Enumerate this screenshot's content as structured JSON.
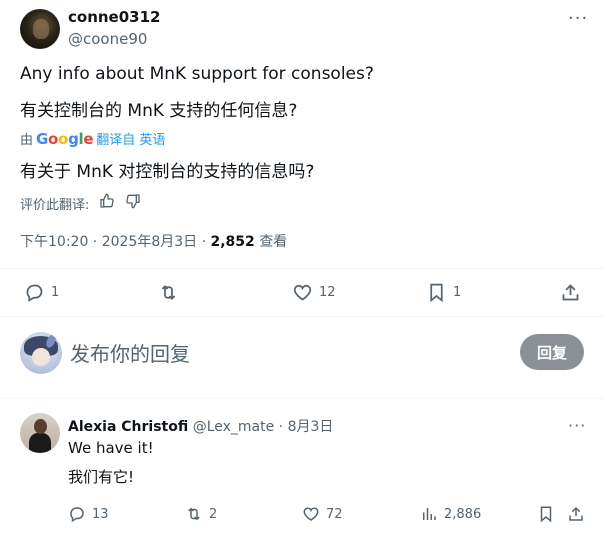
{
  "tweet": {
    "display_name": "conne0312",
    "handle": "@coone90",
    "text_en": "Any info about MnK support for consoles?",
    "text_zh": "有关控制台的 MnK 支持的任何信息?",
    "translate_by": "由",
    "google_logo": "Google",
    "translate_label": "翻译自 英语",
    "translated_text": "有关于 MnK 对控制台的支持的信息吗?",
    "rate_label": "评价此翻译:",
    "timestamp": "下午10:20 · 2025年8月3日 · ",
    "views_count": "2,852",
    "views_label": " 查看",
    "replies": "1",
    "retweets": "",
    "likes": "12",
    "bookmarks": "1"
  },
  "composer": {
    "placeholder": "发布你的回复",
    "reply_button": "回复"
  },
  "reply": {
    "display_name": "Alexia Christofi",
    "handle": " @Lex_mate",
    "date": " · 8月3日",
    "text_en": "We have it!",
    "text_zh": "我们有它!",
    "replies": "13",
    "retweets": "2",
    "likes": "72",
    "views": "2,886"
  },
  "icons": {
    "more": "more-dots-icon",
    "reply": "reply-bubble-icon",
    "retweet": "retweet-icon",
    "like": "heart-icon",
    "bookmark": "bookmark-icon",
    "share": "share-icon",
    "views": "analytics-icon",
    "thumbs_up": "thumbs-up-icon",
    "thumbs_down": "thumbs-down-icon"
  },
  "colors": {
    "text": "#0f1419",
    "secondary": "#536471",
    "link": "#1d9bf0",
    "reply_button_bg": "#8b9096",
    "divider": "#eff3f4"
  }
}
